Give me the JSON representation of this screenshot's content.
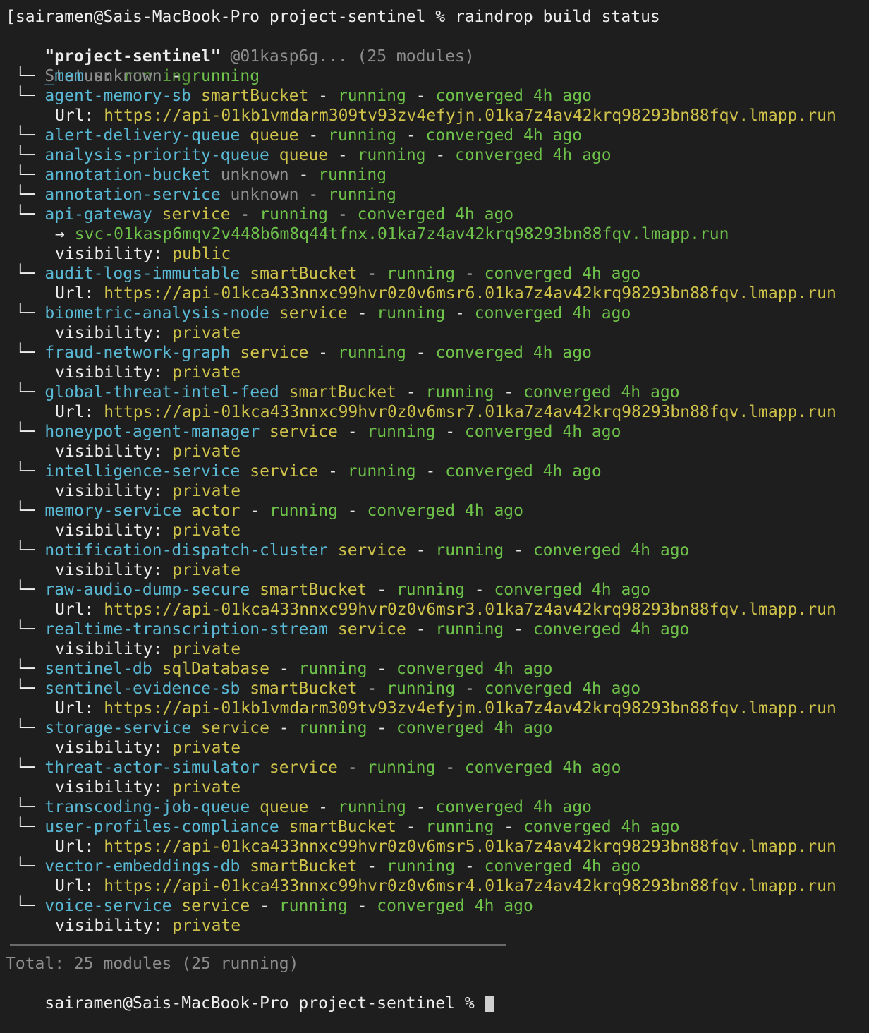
{
  "prompt": "[sairamen@Sais-MacBook-Pro project-sentinel % raindrop build status",
  "project": {
    "name": "\"project-sentinel\"",
    "id": "@01kasp6g...",
    "modules": "(25 modules)"
  },
  "status": {
    "label": "Status:",
    "value": "running"
  },
  "tree_glyph": "└─",
  "rows": [
    {
      "k": "m",
      "name": "_mem",
      "type": "unknown",
      "status": "running",
      "conv": ""
    },
    {
      "k": "m",
      "name": "agent-memory-sb",
      "type": "smartBucket",
      "status": "running",
      "conv": "converged 4h ago"
    },
    {
      "k": "u",
      "label": "Url:",
      "value": "https://api-01kb1vmdarm309tv93zv4efyjn.01ka7z4av42krq98293bn88fqv.lmapp.run"
    },
    {
      "k": "m",
      "name": "alert-delivery-queue",
      "type": "queue",
      "status": "running",
      "conv": "converged 4h ago"
    },
    {
      "k": "m",
      "name": "analysis-priority-queue",
      "type": "queue",
      "status": "running",
      "conv": "converged 4h ago"
    },
    {
      "k": "m",
      "name": "annotation-bucket",
      "type": "unknown",
      "status": "running",
      "conv": ""
    },
    {
      "k": "m",
      "name": "annotation-service",
      "type": "unknown",
      "status": "running",
      "conv": ""
    },
    {
      "k": "m",
      "name": "api-gateway",
      "type": "service",
      "status": "running",
      "conv": "converged 4h ago"
    },
    {
      "k": "a",
      "arrow": "→",
      "value": "svc-01kasp6mqv2v448b6m8q44tfnx.01ka7z4av42krq98293bn88fqv.lmapp.run"
    },
    {
      "k": "v",
      "label": "visibility:",
      "value": "public"
    },
    {
      "k": "m",
      "name": "audit-logs-immutable",
      "type": "smartBucket",
      "status": "running",
      "conv": "converged 4h ago"
    },
    {
      "k": "u",
      "label": "Url:",
      "value": "https://api-01kca433nnxc99hvr0z0v6msr6.01ka7z4av42krq98293bn88fqv.lmapp.run"
    },
    {
      "k": "m",
      "name": "biometric-analysis-node",
      "type": "service",
      "status": "running",
      "conv": "converged 4h ago"
    },
    {
      "k": "v",
      "label": "visibility:",
      "value": "private"
    },
    {
      "k": "m",
      "name": "fraud-network-graph",
      "type": "service",
      "status": "running",
      "conv": "converged 4h ago"
    },
    {
      "k": "v",
      "label": "visibility:",
      "value": "private"
    },
    {
      "k": "m",
      "name": "global-threat-intel-feed",
      "type": "smartBucket",
      "status": "running",
      "conv": "converged 4h ago"
    },
    {
      "k": "u",
      "label": "Url:",
      "value": "https://api-01kca433nnxc99hvr0z0v6msr7.01ka7z4av42krq98293bn88fqv.lmapp.run"
    },
    {
      "k": "m",
      "name": "honeypot-agent-manager",
      "type": "service",
      "status": "running",
      "conv": "converged 4h ago"
    },
    {
      "k": "v",
      "label": "visibility:",
      "value": "private"
    },
    {
      "k": "m",
      "name": "intelligence-service",
      "type": "service",
      "status": "running",
      "conv": "converged 4h ago"
    },
    {
      "k": "v",
      "label": "visibility:",
      "value": "private"
    },
    {
      "k": "m",
      "name": "memory-service",
      "type": "actor",
      "status": "running",
      "conv": "converged 4h ago"
    },
    {
      "k": "v",
      "label": "visibility:",
      "value": "private"
    },
    {
      "k": "m",
      "name": "notification-dispatch-cluster",
      "type": "service",
      "status": "running",
      "conv": "converged 4h ago"
    },
    {
      "k": "v",
      "label": "visibility:",
      "value": "private"
    },
    {
      "k": "m",
      "name": "raw-audio-dump-secure",
      "type": "smartBucket",
      "status": "running",
      "conv": "converged 4h ago"
    },
    {
      "k": "u",
      "label": "Url:",
      "value": "https://api-01kca433nnxc99hvr0z0v6msr3.01ka7z4av42krq98293bn88fqv.lmapp.run"
    },
    {
      "k": "m",
      "name": "realtime-transcription-stream",
      "type": "service",
      "status": "running",
      "conv": "converged 4h ago"
    },
    {
      "k": "v",
      "label": "visibility:",
      "value": "private"
    },
    {
      "k": "m",
      "name": "sentinel-db",
      "type": "sqlDatabase",
      "status": "running",
      "conv": "converged 4h ago"
    },
    {
      "k": "m",
      "name": "sentinel-evidence-sb",
      "type": "smartBucket",
      "status": "running",
      "conv": "converged 4h ago"
    },
    {
      "k": "u",
      "label": "Url:",
      "value": "https://api-01kb1vmdarm309tv93zv4efyjm.01ka7z4av42krq98293bn88fqv.lmapp.run"
    },
    {
      "k": "m",
      "name": "storage-service",
      "type": "service",
      "status": "running",
      "conv": "converged 4h ago"
    },
    {
      "k": "v",
      "label": "visibility:",
      "value": "private"
    },
    {
      "k": "m",
      "name": "threat-actor-simulator",
      "type": "service",
      "status": "running",
      "conv": "converged 4h ago"
    },
    {
      "k": "v",
      "label": "visibility:",
      "value": "private"
    },
    {
      "k": "m",
      "name": "transcoding-job-queue",
      "type": "queue",
      "status": "running",
      "conv": "converged 4h ago"
    },
    {
      "k": "m",
      "name": "user-profiles-compliance",
      "type": "smartBucket",
      "status": "running",
      "conv": "converged 4h ago"
    },
    {
      "k": "u",
      "label": "Url:",
      "value": "https://api-01kca433nnxc99hvr0z0v6msr5.01ka7z4av42krq98293bn88fqv.lmapp.run"
    },
    {
      "k": "m",
      "name": "vector-embeddings-db",
      "type": "smartBucket",
      "status": "running",
      "conv": "converged 4h ago"
    },
    {
      "k": "u",
      "label": "Url:",
      "value": "https://api-01kca433nnxc99hvr0z0v6msr4.01ka7z4av42krq98293bn88fqv.lmapp.run"
    },
    {
      "k": "m",
      "name": "voice-service",
      "type": "service",
      "status": "running",
      "conv": "converged 4h ago"
    },
    {
      "k": "v",
      "label": "visibility:",
      "value": "private"
    }
  ],
  "total": "Total: 25 modules (25 running)",
  "next_prompt": "sairamen@Sais-MacBook-Pro project-sentinel %"
}
